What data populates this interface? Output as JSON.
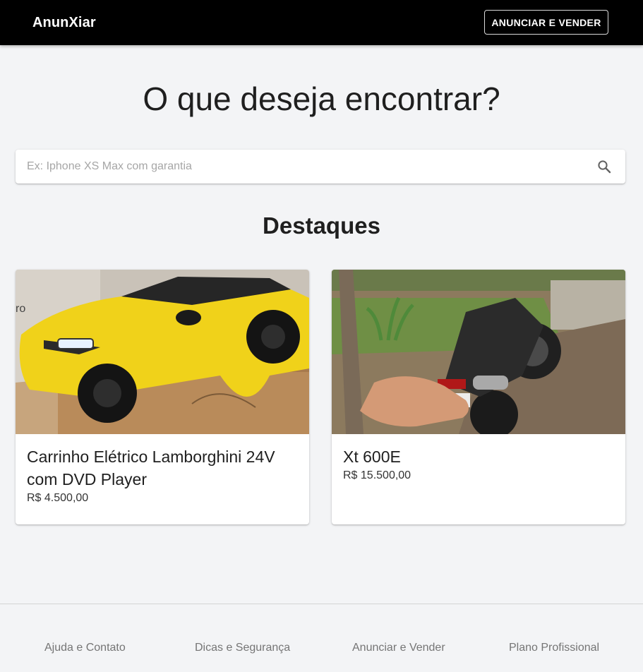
{
  "header": {
    "brand": "AnunXiar",
    "cta_label": "ANUNCIAR E VENDER"
  },
  "hero": {
    "title": "O que deseja encontrar?"
  },
  "search": {
    "placeholder": "Ex: Iphone XS Max com garantia",
    "value": "",
    "icon": "search-icon"
  },
  "featured": {
    "title": "Destaques",
    "items": [
      {
        "title": "Carrinho Elétrico Lamborghini 24V com DVD Player",
        "price": "R$ 4.500,00",
        "image": "yellow toy Lamborghini ride-on car on cardboard box"
      },
      {
        "title": "Xt 600E",
        "price": "R$ 15.500,00",
        "image": "motorcycle parked in a backyard"
      }
    ]
  },
  "footer": {
    "links": [
      "Ajuda e Contato",
      "Dicas e Segurança",
      "Anunciar e Vender",
      "Plano Profissional"
    ]
  },
  "colors": {
    "header_bg": "#000000",
    "page_bg": "#f3f4f6",
    "card_bg": "#ffffff",
    "footer_link": "#757575"
  }
}
